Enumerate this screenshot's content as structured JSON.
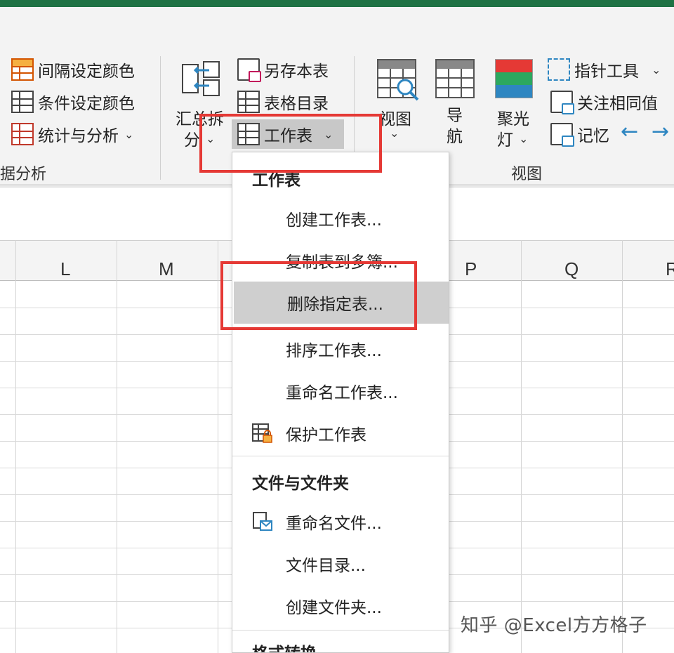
{
  "ribbon": {
    "left_group": {
      "items": [
        "间隔设定颜色",
        "条件设定颜色",
        "统计与分析"
      ],
      "label": "据分析"
    },
    "middle_group": {
      "summary_split": [
        "汇总拆",
        "分"
      ],
      "items": [
        "另存本表",
        "表格目录",
        "工作表"
      ]
    },
    "view_group": {
      "view": [
        "视图"
      ],
      "nav": [
        "导",
        "航"
      ],
      "spotlight": [
        "聚光",
        "灯"
      ],
      "items": [
        "指针工具",
        "关注相同值",
        "记忆"
      ],
      "label": "视图"
    }
  },
  "columns": [
    "L",
    "M",
    "P",
    "Q",
    "R"
  ],
  "menu": {
    "section_worksheet": "工作表",
    "items_worksheet": [
      "创建工作表...",
      "复制表到多簿...",
      "删除指定表...",
      "排序工作表...",
      "重命名工作表...",
      "保护工作表"
    ],
    "section_files": "文件与文件夹",
    "items_files": [
      "重命名文件...",
      "文件目录...",
      "创建文件夹..."
    ],
    "section_format": "格式转换"
  },
  "watermark": "知乎 @Excel方方格子",
  "colors": {
    "highlight": "#e53935",
    "accent": "#2e86c1",
    "excel_green": "#1f7244"
  }
}
